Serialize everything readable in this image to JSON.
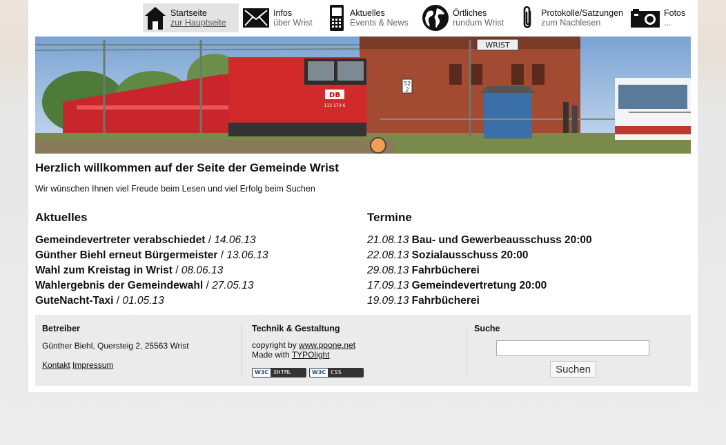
{
  "nav": [
    {
      "title": "Startseite",
      "sub": "zur Hauptseite",
      "icon": "house-icon",
      "active": true
    },
    {
      "title": "Infos",
      "sub": "über Wrist",
      "icon": "envelope-icon"
    },
    {
      "title": "Aktuelles",
      "sub": "Events & News",
      "icon": "mobile-phone-icon"
    },
    {
      "title": "Örtliches",
      "sub": "rundum Wrist",
      "icon": "globe-icon"
    },
    {
      "title": "Protokolle/Satzungen",
      "sub": "zum Nachlesen",
      "icon": "paperclip-icon"
    },
    {
      "title": "Fotos",
      "sub": "...",
      "icon": "camera-icon"
    }
  ],
  "banner": {
    "station_sign": "WRIST",
    "loco_logo": "DB",
    "loco_number": "112 173-6",
    "platform_sign": "52",
    "platform_sign_2": "2"
  },
  "welcome": {
    "title": "Herzlich willkommen auf der Seite der Gemeinde Wrist",
    "text": "Wir wünschen Ihnen viel Freude beim Lesen und viel Erfolg beim Suchen"
  },
  "aktuelles": {
    "heading": "Aktuelles",
    "items": [
      {
        "title": "Gemeindevertreter verabschiedet",
        "sep": " / ",
        "date": "14.06.13"
      },
      {
        "title": "Günther Biehl erneut Bürgermeister",
        "sep": " / ",
        "date": "13.06.13"
      },
      {
        "title": "Wahl zum Kreistag in Wrist",
        "sep": " / ",
        "date": "08.06.13"
      },
      {
        "title": "Wahlergebnis der Gemeindewahl",
        "sep": " / ",
        "date": "27.05.13"
      },
      {
        "title": "GuteNacht-Taxi",
        "sep": " / ",
        "date": "01.05.13"
      }
    ]
  },
  "termine": {
    "heading": "Termine",
    "items": [
      {
        "date": "21.08.13",
        "title": " Bau- und Gewerbeausschuss 20:00"
      },
      {
        "date": "22.08.13",
        "title": " Sozialausschuss 20:00"
      },
      {
        "date": "29.08.13",
        "title": " Fahrbücherei"
      },
      {
        "date": "17.09.13",
        "title": " Gemeindevertretung 20:00"
      },
      {
        "date": "19.09.13",
        "title": " Fahrbücherei"
      }
    ]
  },
  "footer": {
    "betreiber": {
      "heading": "Betreiber",
      "address": "Günther Biehl, Quersteig 2, 25563 Wrist",
      "kontakt": "Kontakt",
      "impressum": "Impressum"
    },
    "technik": {
      "heading": "Technik & Gestaltung",
      "copyright_prefix": "copyright by ",
      "copyright_link": "www.ppone.net",
      "made_prefix": "Made with ",
      "made_link": "TYPOlight",
      "badge_w3c": "W3C",
      "badge_xhtml": "XHTML 1.0",
      "badge_css": "CSS"
    },
    "suche": {
      "heading": "Suche",
      "value": "",
      "button": "Suchen"
    }
  }
}
